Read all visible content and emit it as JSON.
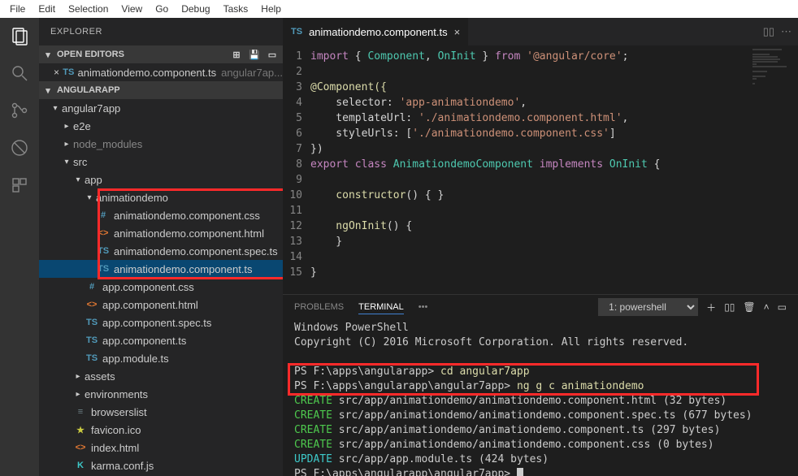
{
  "menubar": [
    "File",
    "Edit",
    "Selection",
    "View",
    "Go",
    "Debug",
    "Tasks",
    "Help"
  ],
  "sidebar": {
    "title": "EXPLORER",
    "sections": {
      "openEditors": "OPEN EDITORS",
      "project": "ANGULARAPP"
    },
    "openEditor": {
      "icon": "TS",
      "name": "animationdemo.component.ts",
      "hint": "angular7ap..."
    },
    "tree": {
      "root": "angular7app",
      "e2e": "e2e",
      "node_modules": "node_modules",
      "src": "src",
      "app": "app",
      "animationdemo": "animationdemo",
      "anim_css": "animationdemo.component.css",
      "anim_html": "animationdemo.component.html",
      "anim_spec": "animationdemo.component.spec.ts",
      "anim_ts": "animationdemo.component.ts",
      "app_css": "app.component.css",
      "app_html": "app.component.html",
      "app_spec": "app.component.spec.ts",
      "app_ts": "app.component.ts",
      "app_module": "app.module.ts",
      "assets": "assets",
      "environments": "environments",
      "browserslist": "browserslist",
      "favicon": "favicon.ico",
      "index": "index.html",
      "karma": "karma.conf.js"
    }
  },
  "tab": {
    "icon": "TS",
    "name": "animationdemo.component.ts"
  },
  "code": {
    "l1a": "import",
    "l1b": " { ",
    "l1c": "Component",
    "l1d": ", ",
    "l1e": "OnInit",
    "l1f": " } ",
    "l1g": "from",
    "l1h": " '@angular/core'",
    "l1i": ";",
    "l3": "@Component({",
    "l4a": "    selector:",
    "l4b": " 'app-animationdemo'",
    "l4c": ",",
    "l5a": "    templateUrl:",
    "l5b": " './animationdemo.component.html'",
    "l5c": ",",
    "l6a": "    styleUrls:",
    "l6b": " [",
    "l6c": "'./animationdemo.component.css'",
    "l6d": "]",
    "l7": "})",
    "l8a": "export",
    "l8b": " class",
    "l8c": " AnimationdemoComponent",
    "l8d": " implements",
    "l8e": " OnInit",
    "l8f": " {",
    "l10a": "    constructor",
    "l10b": "() { }",
    "l12a": "    ngOnInit",
    "l12b": "() {",
    "l13": "    }",
    "l15": "}"
  },
  "panel": {
    "problems": "PROBLEMS",
    "terminal": "TERMINAL",
    "dots": "•••",
    "dropdown": "1: powershell"
  },
  "terminal": {
    "l1": "Windows PowerShell",
    "l2": "Copyright (C) 2016 Microsoft Corporation. All rights reserved.",
    "l4p": "PS F:\\apps\\angularapp> ",
    "l4c": "cd angular7app",
    "l5p": "PS F:\\apps\\angularapp\\angular7app> ",
    "l5c": "ng g c animationdemo",
    "l6a": "CREATE",
    "l6b": " src/app/animationdemo/animationdemo.component.html (32 bytes)",
    "l7a": "CREATE",
    "l7b": " src/app/animationdemo/animationdemo.component.spec.ts (677 bytes)",
    "l8a": "CREATE",
    "l8b": " src/app/animationdemo/animationdemo.component.ts (297 bytes)",
    "l9a": "CREATE",
    "l9b": " src/app/animationdemo/animationdemo.component.css (0 bytes)",
    "l10a": "UPDATE",
    "l10b": " src/app/app.module.ts (424 bytes)",
    "l11p": "PS F:\\apps\\angularapp\\angular7app> "
  }
}
